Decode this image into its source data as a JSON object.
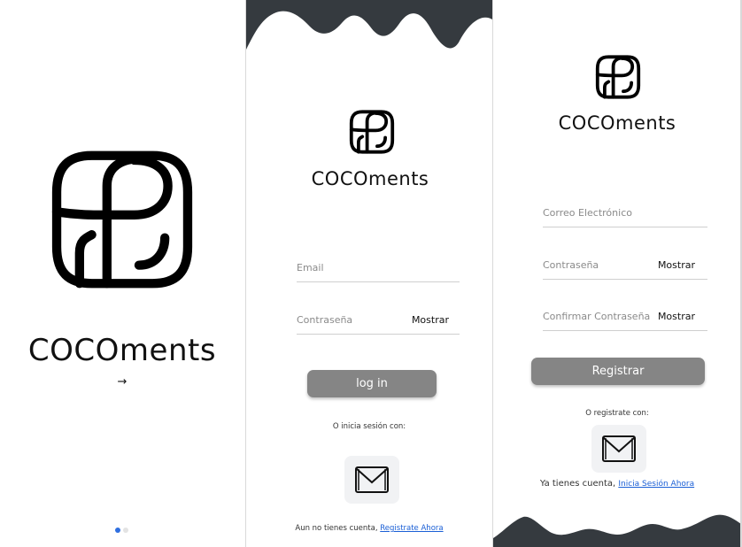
{
  "brand_name": "COCOments",
  "onboarding": {
    "next_arrow": "→",
    "pages_total": 2,
    "page_current": 1
  },
  "login": {
    "email_placeholder": "Email",
    "password_placeholder": "Contraseña",
    "show_password": "Mostrar",
    "login_button": "log in",
    "alt_signin": "O inicia sesión con:",
    "no_account_text": "Aun no tienes cuenta, ",
    "register_link": "Registrate Ahora"
  },
  "register": {
    "email_placeholder": "Correo Electrónico",
    "password_placeholder": "Contraseña",
    "show_password": "Mostrar",
    "confirm_placeholder": "Confirmar Contraseña",
    "show_confirm": "Mostrar",
    "register_button": "Registrar",
    "alt_register": "O registrate con:",
    "have_account_text": "Ya tienes cuenta, ",
    "login_link": "Inicia Sesión Ahora"
  },
  "colors": {
    "wave": "#353a3f",
    "button": "#858585",
    "link": "#1a5fd6",
    "dot_active": "#2f6fe0",
    "dot_inactive": "#e3e3e3"
  },
  "icons": [
    "coco-logo-icon",
    "mail-icon",
    "arrow-right-icon"
  ]
}
